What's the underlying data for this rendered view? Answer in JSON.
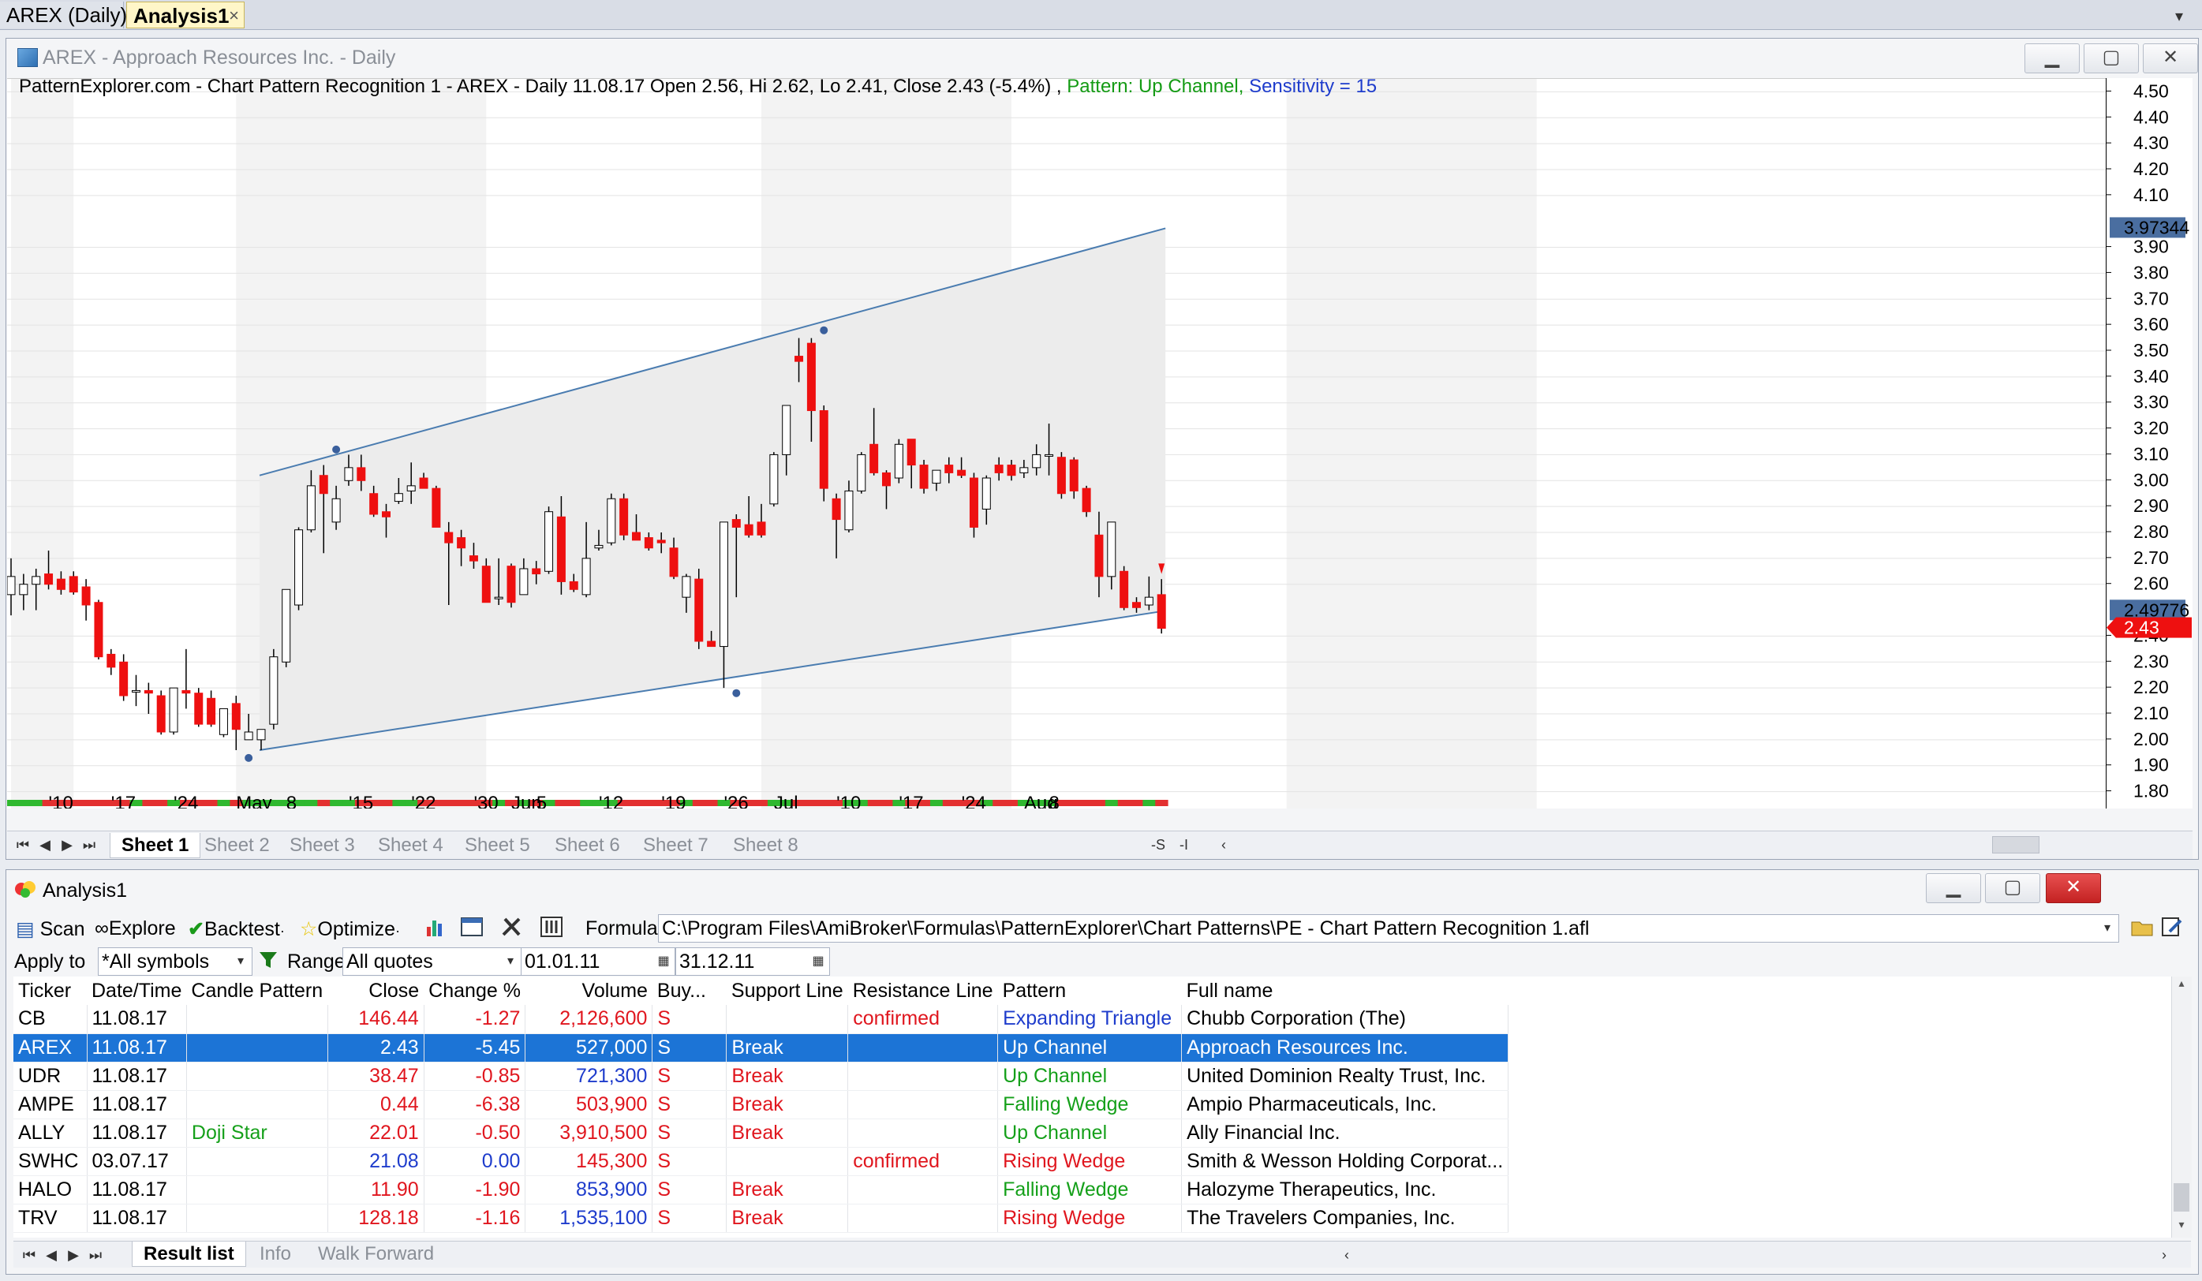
{
  "doc_tabs": {
    "chart_tab": "AREX (Daily)",
    "analysis_tab": "Analysis1"
  },
  "chart_window": {
    "title": "AREX - Approach Resources Inc. - Daily",
    "info_main": "PatternExplorer.com - Chart Pattern Recognition 1 - AREX - Daily 11.08.17 Open 2.56, Hi 2.62, Lo 2.41, Close 2.43 (-5.4%) ,",
    "info_pattern": "Pattern: Up Channel,",
    "info_sensitivity": "Sensitivity = 15",
    "price_ticks": [
      "4.50",
      "4.40",
      "4.30",
      "4.20",
      "4.10",
      "3.90",
      "3.80",
      "3.70",
      "3.60",
      "3.50",
      "3.40",
      "3.30",
      "3.20",
      "3.10",
      "3.00",
      "2.90",
      "2.80",
      "2.70",
      "2.60",
      "2.40",
      "2.30",
      "2.20",
      "2.10",
      "2.00",
      "1.90",
      "1.80"
    ],
    "marker_upper": "3.97344",
    "marker_lower": "2.49776",
    "marker_close": "2.43",
    "date_labels": [
      "'10",
      "'17",
      "'24",
      "May",
      "8",
      "'15",
      "'22",
      "'30",
      "Jun",
      "5",
      "'12",
      "'19",
      "'26",
      "Jul",
      "'10",
      "'17",
      "'24",
      "Aug",
      "8"
    ],
    "sheets": [
      "Sheet 1",
      "Sheet 2",
      "Sheet 3",
      "Sheet 4",
      "Sheet 5",
      "Sheet 6",
      "Sheet 7",
      "Sheet 8"
    ],
    "sheet_extras": [
      "-S",
      "-I"
    ],
    "colors": {
      "up_candle": "#ffffff",
      "down_candle": "#ee1010",
      "channel_line": "#4a7cb0",
      "channel_fill": "#ececec",
      "marker_blue": "#3a5f9c",
      "marker_red": "#ee1010"
    }
  },
  "chart_data": {
    "type": "candlestick",
    "title": "AREX - Approach Resources Inc. - Daily",
    "ylim": [
      1.75,
      4.55
    ],
    "candles": [
      {
        "o": 2.56,
        "h": 2.7,
        "l": 2.48,
        "c": 2.63
      },
      {
        "o": 2.56,
        "h": 2.64,
        "l": 2.5,
        "c": 2.6
      },
      {
        "o": 2.6,
        "h": 2.66,
        "l": 2.5,
        "c": 2.63
      },
      {
        "o": 2.64,
        "h": 2.73,
        "l": 2.58,
        "c": 2.6
      },
      {
        "o": 2.62,
        "h": 2.65,
        "l": 2.56,
        "c": 2.58
      },
      {
        "o": 2.63,
        "h": 2.65,
        "l": 2.56,
        "c": 2.57
      },
      {
        "o": 2.59,
        "h": 2.62,
        "l": 2.46,
        "c": 2.52
      },
      {
        "o": 2.53,
        "h": 2.54,
        "l": 2.31,
        "c": 2.32
      },
      {
        "o": 2.33,
        "h": 2.35,
        "l": 2.25,
        "c": 2.28
      },
      {
        "o": 2.3,
        "h": 2.33,
        "l": 2.15,
        "c": 2.17
      },
      {
        "o": 2.19,
        "h": 2.25,
        "l": 2.13,
        "c": 2.19
      },
      {
        "o": 2.19,
        "h": 2.22,
        "l": 2.1,
        "c": 2.18
      },
      {
        "o": 2.17,
        "h": 2.19,
        "l": 2.02,
        "c": 2.03
      },
      {
        "o": 2.03,
        "h": 2.2,
        "l": 2.02,
        "c": 2.2
      },
      {
        "o": 2.19,
        "h": 2.35,
        "l": 2.12,
        "c": 2.18
      },
      {
        "o": 2.18,
        "h": 2.2,
        "l": 2.05,
        "c": 2.06
      },
      {
        "o": 2.16,
        "h": 2.19,
        "l": 2.05,
        "c": 2.06
      },
      {
        "o": 2.02,
        "h": 2.12,
        "l": 2.01,
        "c": 2.12
      },
      {
        "o": 2.14,
        "h": 2.17,
        "l": 1.96,
        "c": 2.04
      },
      {
        "o": 2.0,
        "h": 2.1,
        "l": 2.0,
        "c": 2.03
      },
      {
        "o": 2.0,
        "h": 2.04,
        "l": 1.96,
        "c": 2.04
      },
      {
        "o": 2.06,
        "h": 2.35,
        "l": 2.04,
        "c": 2.32
      },
      {
        "o": 2.3,
        "h": 2.58,
        "l": 2.28,
        "c": 2.58
      },
      {
        "o": 2.52,
        "h": 2.82,
        "l": 2.5,
        "c": 2.81
      },
      {
        "o": 2.81,
        "h": 3.04,
        "l": 2.8,
        "c": 2.98
      },
      {
        "o": 3.02,
        "h": 3.06,
        "l": 2.72,
        "c": 2.95
      },
      {
        "o": 2.84,
        "h": 2.98,
        "l": 2.81,
        "c": 2.93
      },
      {
        "o": 3.0,
        "h": 3.1,
        "l": 2.98,
        "c": 3.05
      },
      {
        "o": 3.05,
        "h": 3.1,
        "l": 2.96,
        "c": 3.0
      },
      {
        "o": 2.95,
        "h": 2.98,
        "l": 2.86,
        "c": 2.87
      },
      {
        "o": 2.88,
        "h": 2.91,
        "l": 2.78,
        "c": 2.86
      },
      {
        "o": 2.92,
        "h": 3.01,
        "l": 2.91,
        "c": 2.95
      },
      {
        "o": 2.96,
        "h": 3.07,
        "l": 2.91,
        "c": 2.98
      },
      {
        "o": 3.01,
        "h": 3.03,
        "l": 2.98,
        "c": 2.97
      },
      {
        "o": 2.97,
        "h": 2.98,
        "l": 2.85,
        "c": 2.82
      },
      {
        "o": 2.8,
        "h": 2.84,
        "l": 2.52,
        "c": 2.76
      },
      {
        "o": 2.78,
        "h": 2.81,
        "l": 2.67,
        "c": 2.74
      },
      {
        "o": 2.71,
        "h": 2.76,
        "l": 2.66,
        "c": 2.69
      },
      {
        "o": 2.67,
        "h": 2.7,
        "l": 2.53,
        "c": 2.53
      },
      {
        "o": 2.55,
        "h": 2.7,
        "l": 2.52,
        "c": 2.55
      },
      {
        "o": 2.67,
        "h": 2.68,
        "l": 2.51,
        "c": 2.53
      },
      {
        "o": 2.56,
        "h": 2.7,
        "l": 2.56,
        "c": 2.66
      },
      {
        "o": 2.66,
        "h": 2.69,
        "l": 2.6,
        "c": 2.64
      },
      {
        "o": 2.65,
        "h": 2.9,
        "l": 2.64,
        "c": 2.88
      },
      {
        "o": 2.86,
        "h": 2.94,
        "l": 2.56,
        "c": 2.61
      },
      {
        "o": 2.61,
        "h": 2.64,
        "l": 2.57,
        "c": 2.58
      },
      {
        "o": 2.56,
        "h": 2.84,
        "l": 2.55,
        "c": 2.7
      },
      {
        "o": 2.74,
        "h": 2.81,
        "l": 2.73,
        "c": 2.75
      },
      {
        "o": 2.76,
        "h": 2.95,
        "l": 2.75,
        "c": 2.93
      },
      {
        "o": 2.93,
        "h": 2.95,
        "l": 2.77,
        "c": 2.79
      },
      {
        "o": 2.8,
        "h": 2.87,
        "l": 2.78,
        "c": 2.77
      },
      {
        "o": 2.78,
        "h": 2.8,
        "l": 2.73,
        "c": 2.74
      },
      {
        "o": 2.77,
        "h": 2.8,
        "l": 2.72,
        "c": 2.76
      },
      {
        "o": 2.74,
        "h": 2.78,
        "l": 2.62,
        "c": 2.63
      },
      {
        "o": 2.55,
        "h": 2.64,
        "l": 2.49,
        "c": 2.63
      },
      {
        "o": 2.62,
        "h": 2.66,
        "l": 2.35,
        "c": 2.38
      },
      {
        "o": 2.38,
        "h": 2.42,
        "l": 2.36,
        "c": 2.36
      },
      {
        "o": 2.36,
        "h": 2.84,
        "l": 2.2,
        "c": 2.84
      },
      {
        "o": 2.85,
        "h": 2.87,
        "l": 2.55,
        "c": 2.82
      },
      {
        "o": 2.83,
        "h": 2.94,
        "l": 2.78,
        "c": 2.79
      },
      {
        "o": 2.84,
        "h": 2.91,
        "l": 2.78,
        "c": 2.79
      },
      {
        "o": 2.91,
        "h": 3.11,
        "l": 2.9,
        "c": 3.1
      },
      {
        "o": 3.1,
        "h": 3.29,
        "l": 3.02,
        "c": 3.29
      },
      {
        "o": 3.48,
        "h": 3.55,
        "l": 3.38,
        "c": 3.46
      },
      {
        "o": 3.53,
        "h": 3.55,
        "l": 3.15,
        "c": 3.27
      },
      {
        "o": 3.27,
        "h": 3.29,
        "l": 2.92,
        "c": 2.97
      },
      {
        "o": 2.93,
        "h": 2.95,
        "l": 2.7,
        "c": 2.85
      },
      {
        "o": 2.81,
        "h": 3.0,
        "l": 2.8,
        "c": 2.96
      },
      {
        "o": 2.96,
        "h": 3.11,
        "l": 2.95,
        "c": 3.1
      },
      {
        "o": 3.14,
        "h": 3.28,
        "l": 3.02,
        "c": 3.03
      },
      {
        "o": 3.03,
        "h": 3.04,
        "l": 2.89,
        "c": 2.98
      },
      {
        "o": 3.01,
        "h": 3.16,
        "l": 2.99,
        "c": 3.14
      },
      {
        "o": 3.16,
        "h": 3.16,
        "l": 2.97,
        "c": 3.06
      },
      {
        "o": 3.06,
        "h": 3.08,
        "l": 2.95,
        "c": 2.97
      },
      {
        "o": 2.99,
        "h": 3.04,
        "l": 2.96,
        "c": 3.04
      },
      {
        "o": 3.06,
        "h": 3.09,
        "l": 2.99,
        "c": 3.03
      },
      {
        "o": 3.04,
        "h": 3.09,
        "l": 3.01,
        "c": 3.02
      },
      {
        "o": 3.01,
        "h": 3.03,
        "l": 2.78,
        "c": 2.82
      },
      {
        "o": 2.89,
        "h": 3.02,
        "l": 2.83,
        "c": 3.01
      },
      {
        "o": 3.06,
        "h": 3.09,
        "l": 3.0,
        "c": 3.03
      },
      {
        "o": 3.06,
        "h": 3.08,
        "l": 3.0,
        "c": 3.02
      },
      {
        "o": 3.03,
        "h": 3.08,
        "l": 3.01,
        "c": 3.05
      },
      {
        "o": 3.05,
        "h": 3.14,
        "l": 3.02,
        "c": 3.1
      },
      {
        "o": 3.1,
        "h": 3.22,
        "l": 3.02,
        "c": 3.1
      },
      {
        "o": 3.09,
        "h": 3.11,
        "l": 2.93,
        "c": 2.95
      },
      {
        "o": 3.08,
        "h": 3.09,
        "l": 2.93,
        "c": 2.96
      },
      {
        "o": 2.97,
        "h": 2.98,
        "l": 2.86,
        "c": 2.88
      },
      {
        "o": 2.79,
        "h": 2.88,
        "l": 2.55,
        "c": 2.63
      },
      {
        "o": 2.63,
        "h": 2.84,
        "l": 2.58,
        "c": 2.84
      },
      {
        "o": 2.65,
        "h": 2.67,
        "l": 2.5,
        "c": 2.51
      },
      {
        "o": 2.53,
        "h": 2.55,
        "l": 2.49,
        "c": 2.51
      },
      {
        "o": 2.52,
        "h": 2.63,
        "l": 2.5,
        "c": 2.55
      },
      {
        "o": 2.56,
        "h": 2.62,
        "l": 2.41,
        "c": 2.43
      }
    ],
    "channel": {
      "upper": {
        "start_index": 20,
        "start_value": 3.02,
        "end_value": 3.97344
      },
      "lower": {
        "start_index": 20,
        "start_value": 1.96,
        "end_value": 2.49776
      }
    }
  },
  "analysis": {
    "title": "Analysis1",
    "toolbar": {
      "scan": "Scan",
      "explore": "Explore",
      "backtest": "Backtest",
      "optimize": "Optimize",
      "formula_label": "Formula",
      "formula_value": "C:\\Program Files\\AmiBroker\\Formulas\\PatternExplorer\\Chart Patterns\\PE - Chart Pattern Recognition 1.afl",
      "apply_to_label": "Apply to",
      "apply_to_value": "*All symbols",
      "range_label": "Range",
      "range_value": "All quotes",
      "from_date": "01.01.11",
      "to_date": "31.12.11"
    },
    "columns": [
      "Ticker",
      "Date/Time",
      "Candle Pattern",
      "Close",
      "Change %",
      "Volume",
      "Buy...",
      "Support Line",
      "Resistance Line",
      "Pattern",
      "Full name"
    ],
    "rows": [
      {
        "ticker": "CB",
        "date": "11.08.17",
        "candle": "",
        "close": "146.44",
        "change": "-1.27",
        "volume": "2,126,600",
        "buy": "S",
        "support": "",
        "resistance": "confirmed",
        "pattern": "Expanding Triangle",
        "name": "Chubb Corporation (The)",
        "close_color": "red",
        "change_color": "red",
        "volume_color": "red",
        "pattern_color": "blue"
      },
      {
        "ticker": "AREX",
        "date": "11.08.17",
        "candle": "",
        "close": "2.43",
        "change": "-5.45",
        "volume": "527,000",
        "buy": "S",
        "support": "Break",
        "resistance": "",
        "pattern": "Up Channel",
        "name": "Approach Resources Inc.",
        "close_color": "red",
        "change_color": "red",
        "volume_color": "red",
        "pattern_color": "green",
        "selected": true
      },
      {
        "ticker": "UDR",
        "date": "11.08.17",
        "candle": "",
        "close": "38.47",
        "change": "-0.85",
        "volume": "721,300",
        "buy": "S",
        "support": "Break",
        "resistance": "",
        "pattern": "Up Channel",
        "name": "United Dominion Realty Trust, Inc.",
        "close_color": "red",
        "change_color": "red",
        "volume_color": "blue",
        "pattern_color": "green"
      },
      {
        "ticker": "AMPE",
        "date": "11.08.17",
        "candle": "",
        "close": "0.44",
        "change": "-6.38",
        "volume": "503,900",
        "buy": "S",
        "support": "Break",
        "resistance": "",
        "pattern": "Falling Wedge",
        "name": "Ampio Pharmaceuticals, Inc.",
        "close_color": "red",
        "change_color": "red",
        "volume_color": "red",
        "pattern_color": "green"
      },
      {
        "ticker": "ALLY",
        "date": "11.08.17",
        "candle": "Doji Star",
        "close": "22.01",
        "change": "-0.50",
        "volume": "3,910,500",
        "buy": "S",
        "support": "Break",
        "resistance": "",
        "pattern": "Up Channel",
        "name": "Ally Financial Inc.",
        "close_color": "red",
        "change_color": "red",
        "volume_color": "red",
        "pattern_color": "green"
      },
      {
        "ticker": "SWHC",
        "date": "03.07.17",
        "candle": "",
        "close": "21.08",
        "change": "0.00",
        "volume": "145,300",
        "buy": "S",
        "support": "",
        "resistance": "confirmed",
        "pattern": "Rising Wedge",
        "name": "Smith & Wesson Holding Corporat...",
        "close_color": "blue",
        "change_color": "blue",
        "volume_color": "red",
        "pattern_color": "red"
      },
      {
        "ticker": "HALO",
        "date": "11.08.17",
        "candle": "",
        "close": "11.90",
        "change": "-1.90",
        "volume": "853,900",
        "buy": "S",
        "support": "Break",
        "resistance": "",
        "pattern": "Falling Wedge",
        "name": "Halozyme Therapeutics, Inc.",
        "close_color": "red",
        "change_color": "red",
        "volume_color": "blue",
        "pattern_color": "green"
      },
      {
        "ticker": "TRV",
        "date": "11.08.17",
        "candle": "",
        "close": "128.18",
        "change": "-1.16",
        "volume": "1,535,100",
        "buy": "S",
        "support": "Break",
        "resistance": "",
        "pattern": "Rising Wedge",
        "name": "The Travelers Companies, Inc.",
        "close_color": "red",
        "change_color": "red",
        "volume_color": "blue",
        "pattern_color": "red"
      }
    ],
    "bottom_tabs": [
      "Result list",
      "Info",
      "Walk Forward"
    ]
  }
}
